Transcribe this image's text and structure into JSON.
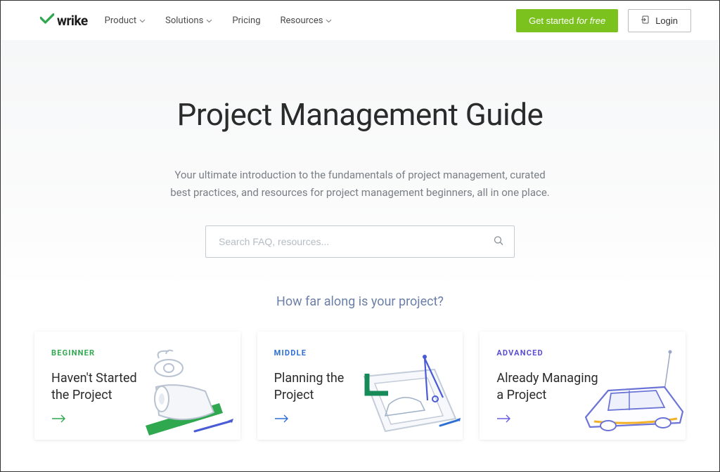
{
  "brand": {
    "name": "wrike"
  },
  "nav": {
    "items": [
      {
        "label": "Product",
        "has_dropdown": true
      },
      {
        "label": "Solutions",
        "has_dropdown": true
      },
      {
        "label": "Pricing",
        "has_dropdown": false
      },
      {
        "label": "Resources",
        "has_dropdown": true
      }
    ]
  },
  "cta": {
    "primary_prefix": "Get started ",
    "primary_suffix": "for free",
    "login": "Login"
  },
  "hero": {
    "title": "Project Management Guide",
    "subtitle": "Your ultimate introduction to the fundamentals of project management, curated best practices, and resources for project management beginners, all in one place."
  },
  "search": {
    "placeholder": "Search FAQ, resources...",
    "value": ""
  },
  "section": {
    "title": "How far along is your project?"
  },
  "cards": [
    {
      "level": "BEGINNER",
      "title": "Haven't Started the Project"
    },
    {
      "level": "MIDDLE",
      "title": "Planning the Project"
    },
    {
      "level": "ADVANCED",
      "title": "Already Managing a Project"
    }
  ],
  "colors": {
    "brand_green": "#7bc21f",
    "beginner": "#2fa84f",
    "middle": "#2f6fd4",
    "advanced": "#5a4dd4"
  }
}
